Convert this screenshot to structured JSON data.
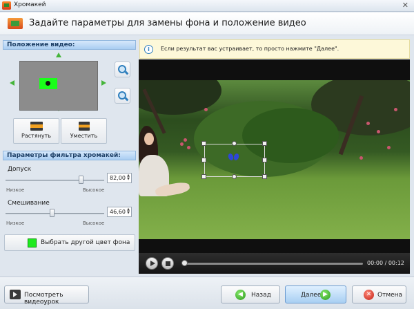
{
  "window": {
    "title": "Хромакей",
    "close_glyph": "✕"
  },
  "header": {
    "title": "Задайте параметры для замены фона и положение видео"
  },
  "position_section": {
    "title": "Положение видео:",
    "stretch_label": "Растянуть",
    "fit_label": "Уместить"
  },
  "filter_section": {
    "title": "Параметры фильтра хромакей:",
    "tolerance": {
      "label": "Допуск",
      "value": "82,00",
      "fraction": 0.76,
      "min_label": "Низкое",
      "max_label": "Высокое"
    },
    "blend": {
      "label": "Смешивание",
      "value": "46,60",
      "fraction": 0.47,
      "min_label": "Низкое",
      "max_label": "Высокое"
    },
    "color_button_label": "Выбрать другой цвет фона",
    "key_color": "#1fea1f"
  },
  "info": {
    "text": "Если результат вас устраивает, то просто нажмите \"Далее\"."
  },
  "player": {
    "time": "00:00 / 00:12",
    "progress_fraction": 0.0
  },
  "footer": {
    "tutorial_label": "Посмотреть видеоурок",
    "back_label": "Назад",
    "next_label": "Далее",
    "cancel_label": "Отмена"
  }
}
